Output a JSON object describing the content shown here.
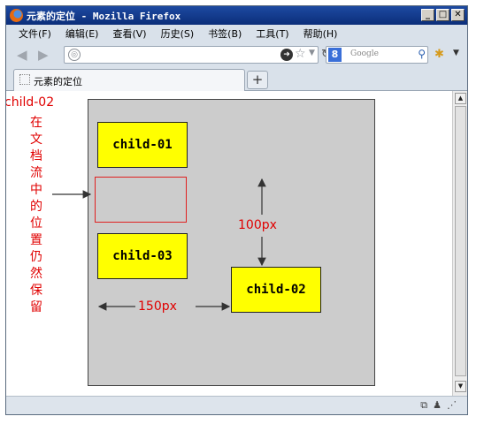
{
  "window": {
    "title": "元素的定位 - Mozilla Firefox",
    "controls": [
      "minimize",
      "maximize",
      "close"
    ]
  },
  "menu": [
    "文件(F)",
    "编辑(E)",
    "查看(V)",
    "历史(S)",
    "书签(B)",
    "工具(T)",
    "帮助(H)"
  ],
  "navbar": {
    "back_icon": "back-arrow-icon",
    "forward_icon": "forward-arrow-icon",
    "url_value": "",
    "search_placeholder": "Google"
  },
  "tabs": [
    {
      "label": "元素的定位"
    }
  ],
  "page": {
    "children": [
      "child-01",
      "child-02",
      "child-03"
    ],
    "label_child02": "child-02",
    "vertical_note": [
      "在",
      "文",
      "档",
      "流",
      "中",
      "的",
      "位",
      "置",
      "仍",
      "然",
      "保",
      "留"
    ],
    "dim_vertical": "100px",
    "dim_horizontal": "150px"
  },
  "colors": {
    "parent_bg": "#cccccc",
    "child_bg": "#ffff00",
    "annotation": "#e00000"
  }
}
